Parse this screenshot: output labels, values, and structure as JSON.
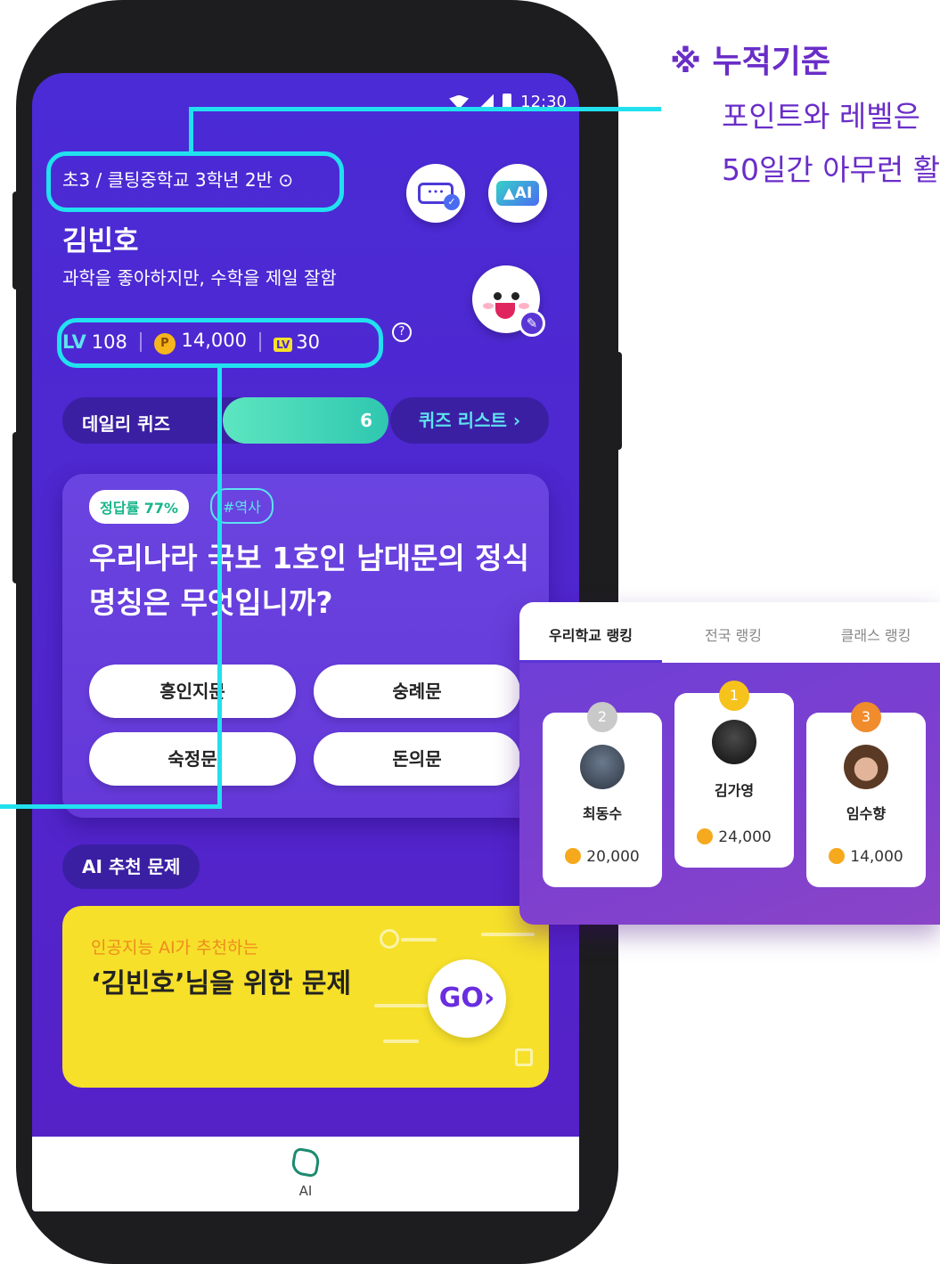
{
  "status": {
    "time": "12:30"
  },
  "profile": {
    "school": "초3 / 클팅중학교 3학년 2반 ⊙",
    "name": "김빈호",
    "bio": "과학을 좋아하지만, 수학을 제일 잘함",
    "level_tag": "LV",
    "level": "108",
    "points": "14,000",
    "tickets": "30",
    "ai_badge": "AI"
  },
  "daily_quiz": {
    "label": "데일리 퀴즈",
    "count": "6",
    "progress": 0.55,
    "list_button": "퀴즈 리스트 ›"
  },
  "quiz_card": {
    "accuracy_tag": "정답률 77%",
    "topic_tag": "#역사",
    "question": "우리나라 국보 1호인 남대문의 정식명칭은 무엇입니까?",
    "answers": [
      "흥인지문",
      "숭례문",
      "숙정문",
      "돈의문"
    ]
  },
  "ai_section": {
    "label": "AI 추천 문제",
    "subtitle": "인공지능 AI가 추천하는",
    "title": "‘김빈호’님을 위한 문제",
    "go": "GO›"
  },
  "nav": {
    "label": "AI"
  },
  "note": {
    "title": "※ 누적기준",
    "line1": "포인트와 레벨은",
    "line2": "50일간 아무런 활"
  },
  "ranking": {
    "tabs": [
      "우리학교 랭킹",
      "전국 랭킹",
      "클래스 랭킹"
    ],
    "entries": [
      {
        "rank": "2",
        "name": "최동수",
        "points": "20,000"
      },
      {
        "rank": "1",
        "name": "김가영",
        "points": "24,000"
      },
      {
        "rank": "3",
        "name": "임수향",
        "points": "14,000"
      }
    ]
  },
  "colors": {
    "screen_bg": "#4f27cf",
    "accent_cyan": "#21e1ef",
    "yellow": "#f6e02a",
    "note_purple": "#6a2dc8"
  }
}
